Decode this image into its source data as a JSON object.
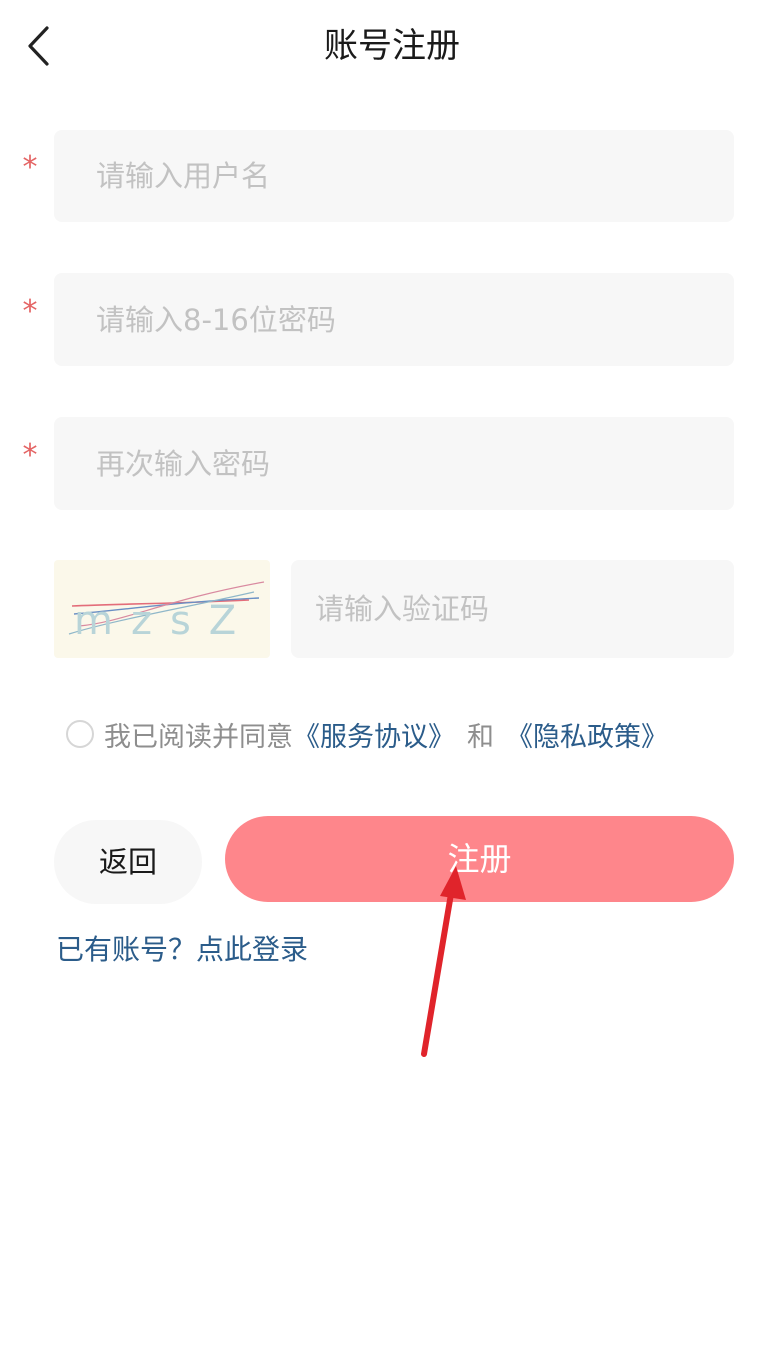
{
  "header": {
    "title": "账号注册",
    "back_icon": "chevron-left-icon"
  },
  "form": {
    "required_mark": "*",
    "username": {
      "placeholder": "请输入用户名",
      "value": ""
    },
    "password": {
      "placeholder": "请输入8-16位密码",
      "value": ""
    },
    "confirm_password": {
      "placeholder": "再次输入密码",
      "value": ""
    },
    "captcha": {
      "image_text": "mzsZ",
      "placeholder": "请输入验证码",
      "value": ""
    }
  },
  "agreement": {
    "checked": false,
    "prefix": "我已阅读并同意",
    "service_link": "《服务协议》",
    "and_text": "和",
    "privacy_link": "《隐私政策》"
  },
  "actions": {
    "back_label": "返回",
    "register_label": "注册"
  },
  "login_link": "已有账号？点此登录",
  "colors": {
    "accent": "#fe868b",
    "link": "#2b5c8a",
    "required": "#e46464",
    "annotation_arrow": "#e0242b"
  }
}
